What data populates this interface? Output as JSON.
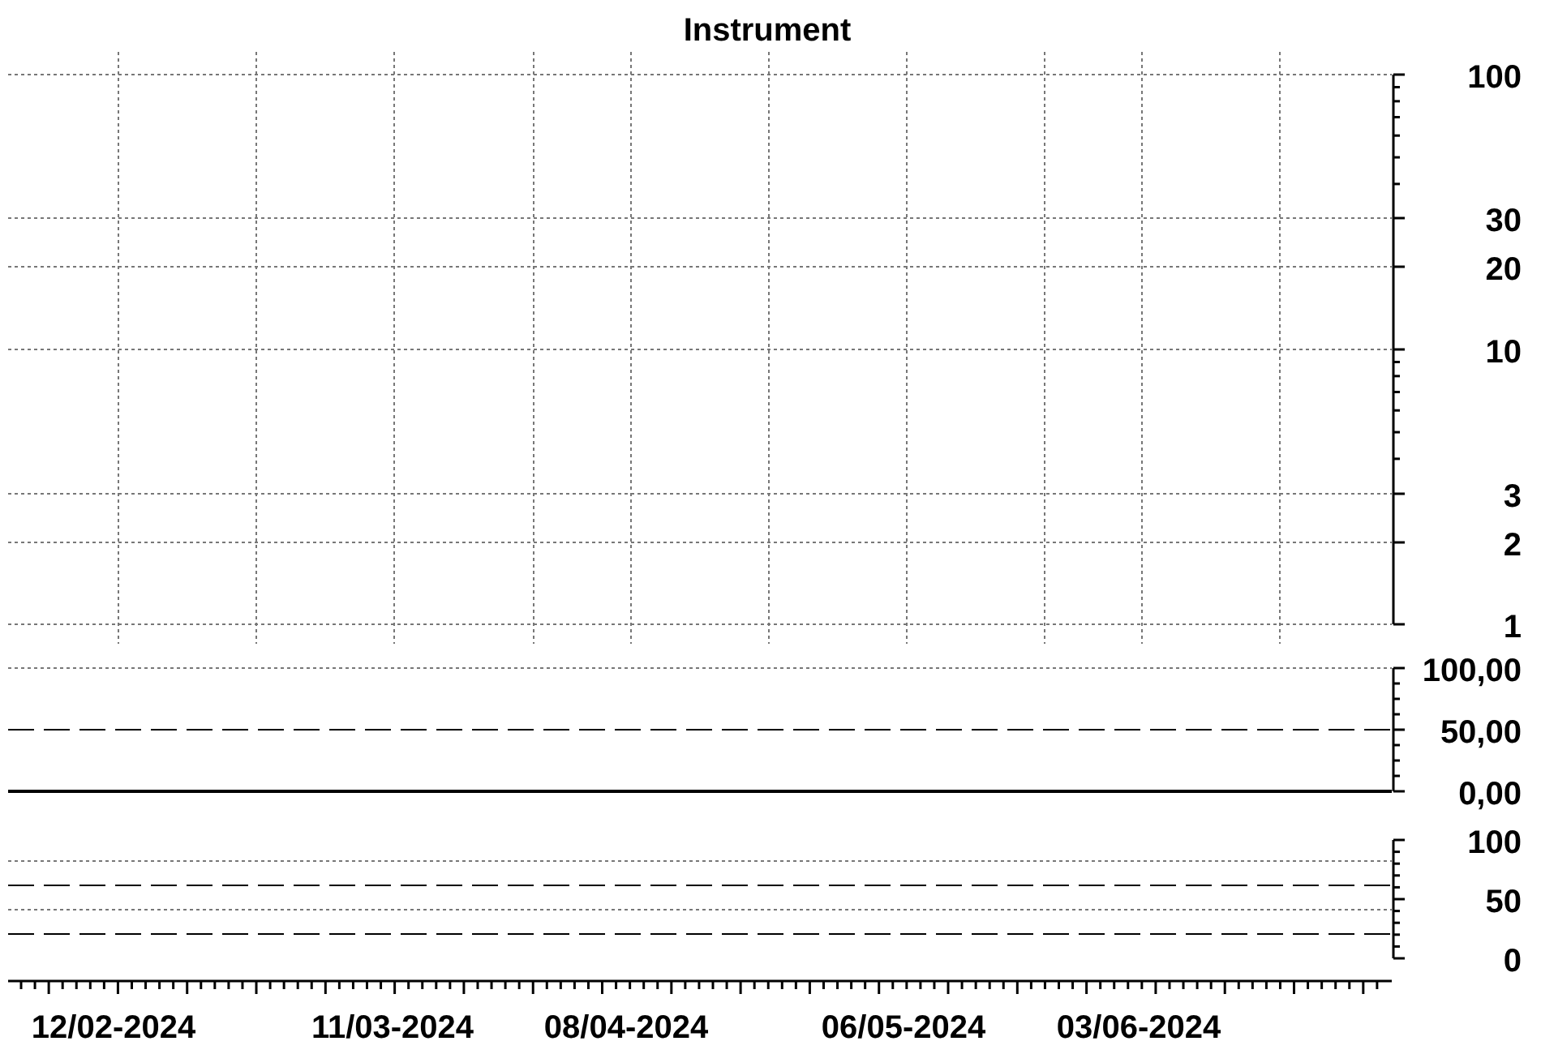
{
  "title": "Instrument",
  "panels": [
    {
      "kind": "log",
      "labels": [
        "100",
        "30",
        "20",
        "10",
        "3",
        "2",
        "1"
      ]
    },
    {
      "kind": "oscillator",
      "labels": [
        "100,00",
        "50,00",
        "0,00"
      ]
    },
    {
      "kind": "band",
      "labels": [
        "100",
        "50",
        "0"
      ]
    }
  ],
  "x_axis": {
    "labels": [
      "12/02-2024",
      "11/03-2024",
      "08/04-2024",
      "06/05-2024",
      "03/06-2024"
    ]
  }
}
